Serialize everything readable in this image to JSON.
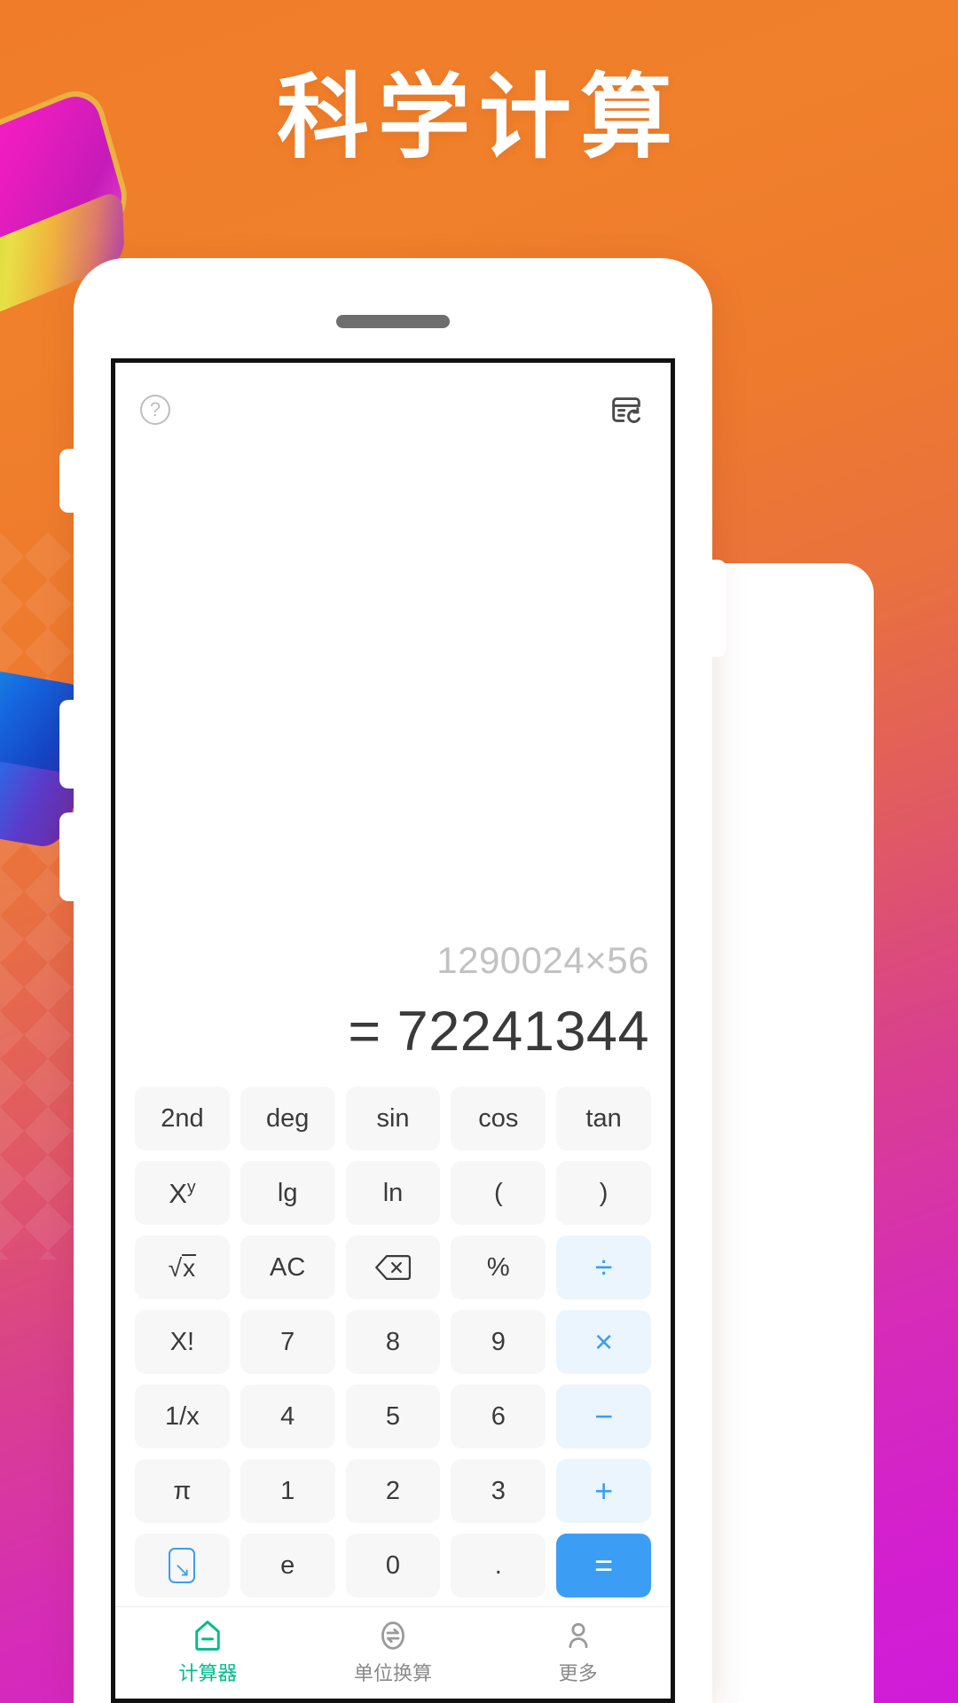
{
  "poster": {
    "headline": "科学计算",
    "bg_start_color": "#F07C2A",
    "bg_end_color": "#D01CD8"
  },
  "app": {
    "topbar": {
      "help_icon": "help-circle-icon",
      "help_glyph": "?",
      "history_icon": "history-record-icon"
    },
    "display": {
      "expression": "1290024×56",
      "result": "= 72241344",
      "expression_color": "#C2C2C2",
      "result_color": "#3A3A3A"
    },
    "keypad": {
      "accent_color": "#3C9DF5",
      "key_bg": "#F7F7F7",
      "op_bg": "#EBF5FE",
      "rows": [
        [
          {
            "label": "2nd",
            "name": "key-2nd",
            "type": "fn"
          },
          {
            "label": "deg",
            "name": "key-deg",
            "type": "fn"
          },
          {
            "label": "sin",
            "name": "key-sin",
            "type": "fn"
          },
          {
            "label": "cos",
            "name": "key-cos",
            "type": "fn"
          },
          {
            "label": "tan",
            "name": "key-tan",
            "type": "fn"
          }
        ],
        [
          {
            "label": "Xy",
            "name": "key-power",
            "type": "fn-sup",
            "base": "X",
            "sup": "y"
          },
          {
            "label": "lg",
            "name": "key-lg",
            "type": "fn"
          },
          {
            "label": "ln",
            "name": "key-ln",
            "type": "fn"
          },
          {
            "label": "(",
            "name": "key-paren-open",
            "type": "fn"
          },
          {
            "label": ")",
            "name": "key-paren-close",
            "type": "fn"
          }
        ],
        [
          {
            "label": "√x",
            "name": "key-sqrt",
            "type": "sqrt"
          },
          {
            "label": "AC",
            "name": "key-all-clear",
            "type": "fn"
          },
          {
            "label": "",
            "name": "key-backspace",
            "type": "backspace-icon"
          },
          {
            "label": "%",
            "name": "key-percent",
            "type": "fn"
          },
          {
            "label": "÷",
            "name": "key-divide",
            "type": "op"
          }
        ],
        [
          {
            "label": "X!",
            "name": "key-factorial",
            "type": "fn"
          },
          {
            "label": "7",
            "name": "key-7",
            "type": "num"
          },
          {
            "label": "8",
            "name": "key-8",
            "type": "num"
          },
          {
            "label": "9",
            "name": "key-9",
            "type": "num"
          },
          {
            "label": "×",
            "name": "key-multiply",
            "type": "op"
          }
        ],
        [
          {
            "label": "1/x",
            "name": "key-reciprocal",
            "type": "fn"
          },
          {
            "label": "4",
            "name": "key-4",
            "type": "num"
          },
          {
            "label": "5",
            "name": "key-5",
            "type": "num"
          },
          {
            "label": "6",
            "name": "key-6",
            "type": "num"
          },
          {
            "label": "−",
            "name": "key-minus",
            "type": "op"
          }
        ],
        [
          {
            "label": "π",
            "name": "key-pi",
            "type": "fn"
          },
          {
            "label": "1",
            "name": "key-1",
            "type": "num"
          },
          {
            "label": "2",
            "name": "key-2",
            "type": "num"
          },
          {
            "label": "3",
            "name": "key-3",
            "type": "num"
          },
          {
            "label": "+",
            "name": "key-plus",
            "type": "op"
          }
        ],
        [
          {
            "label": "↘",
            "name": "key-collapse",
            "type": "collapse-icon"
          },
          {
            "label": "e",
            "name": "key-e",
            "type": "fn"
          },
          {
            "label": "0",
            "name": "key-0",
            "type": "num"
          },
          {
            "label": ".",
            "name": "key-decimal",
            "type": "num"
          },
          {
            "label": "=",
            "name": "key-equals",
            "type": "equals"
          }
        ]
      ]
    },
    "navbar": {
      "active_color": "#04BC8B",
      "inactive_color": "#8A8A8A",
      "items": [
        {
          "label": "计算器",
          "name": "nav-calculator",
          "icon": "home-calculator-icon",
          "active": true
        },
        {
          "label": "单位换算",
          "name": "nav-unit-convert",
          "icon": "unit-convert-icon",
          "active": false
        },
        {
          "label": "更多",
          "name": "nav-more",
          "icon": "person-icon",
          "active": false
        }
      ]
    }
  }
}
